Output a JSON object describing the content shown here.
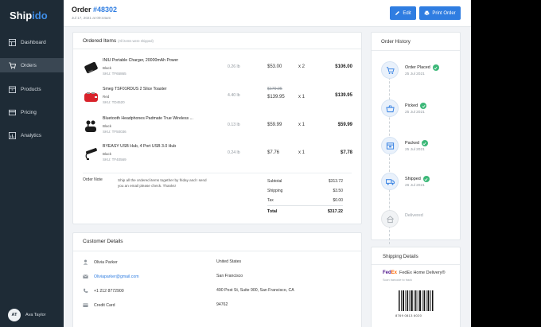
{
  "brand": {
    "part1": "Ship",
    "part2": "ido"
  },
  "nav": [
    {
      "label": "Dashboard",
      "icon": "grid-icon",
      "active": false
    },
    {
      "label": "Orders",
      "icon": "cart-icon",
      "active": true
    },
    {
      "label": "Products",
      "icon": "box-icon",
      "active": false
    },
    {
      "label": "Pricing",
      "icon": "card-icon",
      "active": false
    },
    {
      "label": "Analytics",
      "icon": "chart-icon",
      "active": false
    }
  ],
  "user": {
    "initials": "AT",
    "name": "Ava Taylor"
  },
  "header": {
    "title_prefix": "Order ",
    "order_number": "#48302",
    "date": "Jul 17, 2021 at 09:44am",
    "edit_label": "Edit",
    "print_label": "Print Order"
  },
  "ordered_items": {
    "title": "Ordered Items",
    "subtitle": "(All items were shipped)",
    "items": [
      {
        "name": "INIU Portable Charger, 20000mAh Power",
        "variant": "Black",
        "sku": "SKU: TF65865",
        "weight": "0.26 lb",
        "price": "$53.00",
        "qty": "x  2",
        "total": "$106.00"
      },
      {
        "name": "Smeg TSF01RDUS 2 Slice Toaster",
        "variant": "Red",
        "sku": "SKU: TD4520",
        "weight": "4.40 lb",
        "orig_price": "$179.95",
        "price": "$139.95",
        "qty": "x  1",
        "total": "$139.95"
      },
      {
        "name": "Bluetooth Headphones Padmate True Wireless ...",
        "variant": "Black",
        "sku": "SKU: TF50036",
        "weight": "0.13 lb",
        "price": "$59.99",
        "qty": "x  1",
        "total": "$59.99"
      },
      {
        "name": "BYEASY USB Hub, 4 Port USB 3.0 Hub",
        "variant": "Black",
        "sku": "SKU: TF40569",
        "weight": "0.24 lb",
        "price": "$7.76",
        "qty": "x  1",
        "total": "$7.78"
      }
    ],
    "note_label": "Order Note",
    "note_text": "Ship all the ordered items together by friday and I send you an email please check. Thanks!",
    "summary": [
      {
        "label": "Subtotal",
        "value": "$313.72"
      },
      {
        "label": "Shipping",
        "value": "$3.50"
      },
      {
        "label": "Tax",
        "value": "$0.00"
      }
    ],
    "total_label": "Total",
    "total_value": "$317.22"
  },
  "history": {
    "title": "Order History",
    "steps": [
      {
        "label": "Order Placed",
        "date": "25 Jul 2021",
        "done": true,
        "icon": "cart-icon"
      },
      {
        "label": "Picked",
        "date": "25 Jul 2021",
        "done": true,
        "icon": "basket-icon"
      },
      {
        "label": "Packed",
        "date": "25 Jul 2021",
        "done": true,
        "icon": "package-icon"
      },
      {
        "label": "Shipped",
        "date": "26 Jul 2021",
        "done": true,
        "icon": "truck-icon"
      },
      {
        "label": "Delivered",
        "date": "",
        "done": false,
        "icon": "home-icon"
      }
    ]
  },
  "customer": {
    "title": "Customer Details",
    "name": "Olivia Parker",
    "email": "Oliviaparker@gmail.com",
    "phone": "+1 212 8772900",
    "payment": "Credit Card",
    "country": "United States",
    "city": "San Francisco",
    "street": "490 Post St, Suite 900, San Francisco, CA",
    "zip": "94762"
  },
  "shipping": {
    "title": "Shipping Details",
    "carrier_fe": "Fed",
    "carrier_ex": "Ex",
    "service": "FedEx Home Delivery®",
    "scan_note": "Scan barcode to track",
    "barcode_number": "8769 0813 6020"
  },
  "colors": {
    "accent": "#2f7de1",
    "sidebar": "#1e2b36",
    "success": "#3cb878"
  }
}
